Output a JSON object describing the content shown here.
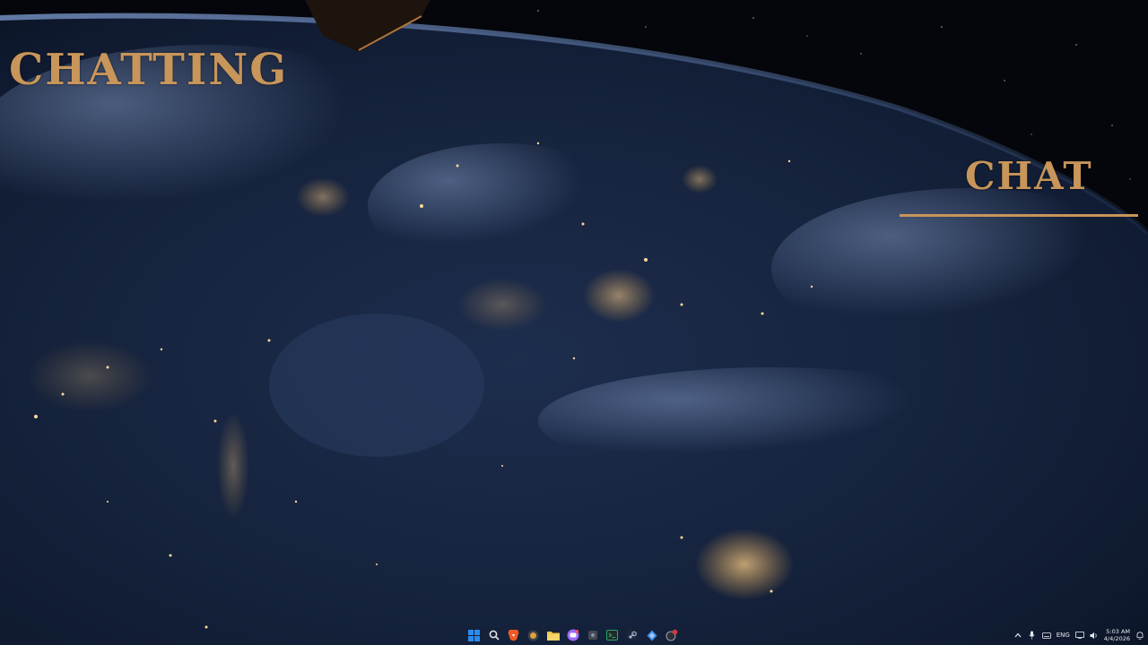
{
  "desktop": {
    "widgets": {
      "chatting_title": "CHATTING",
      "chat_title": "CHAT"
    },
    "accent_color": "#c8955a"
  },
  "taskbar": {
    "apps": [
      {
        "name": "start",
        "icon": "windows-start-icon",
        "color": "#2b8cf0"
      },
      {
        "name": "search",
        "icon": "search-icon",
        "color": "#e8e8e8"
      },
      {
        "name": "brave",
        "icon": "brave-browser-icon",
        "color": "#f15a24"
      },
      {
        "name": "app-circle",
        "icon": "circle-app-icon",
        "color": "#e0a23a"
      },
      {
        "name": "file-explorer",
        "icon": "folder-icon",
        "color": "#f5c542"
      },
      {
        "name": "chat-app",
        "icon": "chat-app-icon",
        "color": "#9b6bff"
      },
      {
        "name": "app-dark",
        "icon": "dark-app-icon",
        "color": "#444a55"
      },
      {
        "name": "terminal",
        "icon": "terminal-icon",
        "color": "#2fa36b"
      },
      {
        "name": "steam",
        "icon": "steam-icon",
        "color": "#9fb4d6"
      },
      {
        "name": "app-diamond",
        "icon": "diamond-app-icon",
        "color": "#3f8fe6"
      },
      {
        "name": "app-red-badge",
        "icon": "red-badge-app-icon",
        "color": "#d63a3a"
      }
    ],
    "tray": {
      "language": "ENG",
      "time": "5:03 AM",
      "date": "4/4/2026"
    }
  }
}
